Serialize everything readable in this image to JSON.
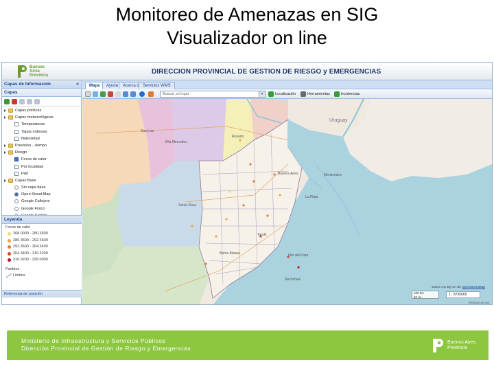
{
  "slide": {
    "title_line1": "Monitoreo de Amenazas en SIG",
    "title_line2": "Visualizador on line"
  },
  "app": {
    "logo_text": "Buenos\nAires\nProvincia",
    "header_title": "DIRECCION PROVINCIAL DE GESTION DE RIESGO y EMERGENCIAS",
    "left_panel": {
      "title": "Capas de Información",
      "collapse": "«",
      "layers_title": "Capas",
      "tree": [
        {
          "label": "Capas políticas",
          "level": 0,
          "type": "folder"
        },
        {
          "label": "Capas meteorológicas",
          "level": 0,
          "type": "folder"
        },
        {
          "label": "Temperaturas",
          "level": 1,
          "type": "check",
          "checked": false
        },
        {
          "label": "Tapas nubosas",
          "level": 1,
          "type": "check",
          "checked": false
        },
        {
          "label": "Nubosidad",
          "level": 1,
          "type": "check",
          "checked": false
        },
        {
          "label": "Previsión ...tiempo",
          "level": 0,
          "type": "folder"
        },
        {
          "label": "Riesgo",
          "level": 0,
          "type": "folder"
        },
        {
          "label": "Focos de calor",
          "level": 1,
          "type": "check",
          "checked": true
        },
        {
          "label": "Por localidad",
          "level": 1,
          "type": "check",
          "checked": false
        },
        {
          "label": "FWI",
          "level": 1,
          "type": "check",
          "checked": false
        },
        {
          "label": "Capas Base",
          "level": 0,
          "type": "folder"
        },
        {
          "label": "Sin capa base",
          "level": 1,
          "type": "radio",
          "checked": false
        },
        {
          "label": "Open Street Map",
          "level": 1,
          "type": "radio",
          "checked": true
        },
        {
          "label": "Google Callejero",
          "level": 1,
          "type": "radio",
          "checked": false
        },
        {
          "label": "Google Físico",
          "level": 1,
          "type": "radio",
          "checked": false
        },
        {
          "label": "Google Satélite",
          "level": 1,
          "type": "radio",
          "checked": false
        }
      ]
    },
    "legend": {
      "title": "Leyenda",
      "subtitle": "Focos de calor",
      "rows": [
        {
          "label": "268.0000 - 280.3600",
          "color": "#f5d76e"
        },
        {
          "label": "280.3600 - 292.3600",
          "color": "#f0a640"
        },
        {
          "label": "292.3600 - 304.3400",
          "color": "#e07a2e"
        },
        {
          "label": "304.3400 - 316.3200",
          "color": "#d4442a"
        },
        {
          "label": "316.3200 - 328.0000",
          "color": "#b0142a"
        }
      ],
      "partidos_label": "Partidos",
      "limites_label": "Límites",
      "footer": "Referencia de posición"
    },
    "tabs": [
      {
        "label": "Mapa",
        "active": true
      },
      {
        "label": "Ayuda",
        "active": false
      },
      {
        "label": "Acerca de",
        "active": false
      },
      {
        "label": "Servicios WMS",
        "active": false
      }
    ],
    "toolbar": {
      "search_placeholder": "Buscar un lugar",
      "localizacion": "Localización",
      "herramientas": "Herramientas",
      "incidencias": "Incidencias"
    },
    "map": {
      "labels": [
        {
          "text": "San Luis"
        },
        {
          "text": "Villa Mercedes"
        },
        {
          "text": "Rosario"
        },
        {
          "text": "Uruguay"
        },
        {
          "text": "Buenos Aires"
        },
        {
          "text": "Montevideo"
        },
        {
          "text": "La Plata"
        },
        {
          "text": "Santa Rosa"
        },
        {
          "text": "Bahía Blanca"
        },
        {
          "text": "Mar del Plata"
        },
        {
          "text": "Necochea"
        },
        {
          "text": "Tandil"
        }
      ],
      "attribution_prefix": "Datos CC-By-SA de",
      "attribution_link": "OpenStreetMap",
      "scale_top": "100 km",
      "scale_bottom": "50 mi",
      "scale_ratio": "1 : 8735665",
      "terms": "Términos de uso"
    }
  },
  "footer": {
    "line1": "Ministerio de Infraestructura y Servicios Públicos",
    "line2": "Dirección Provincial de Gestión de Riesgo y Emergencias",
    "logo_text": "Buenos Aires\nProvincia"
  },
  "colors": {
    "footer_green": "#8dc63f",
    "header_blue": "#1b3a6b",
    "water": "#aad3df"
  }
}
